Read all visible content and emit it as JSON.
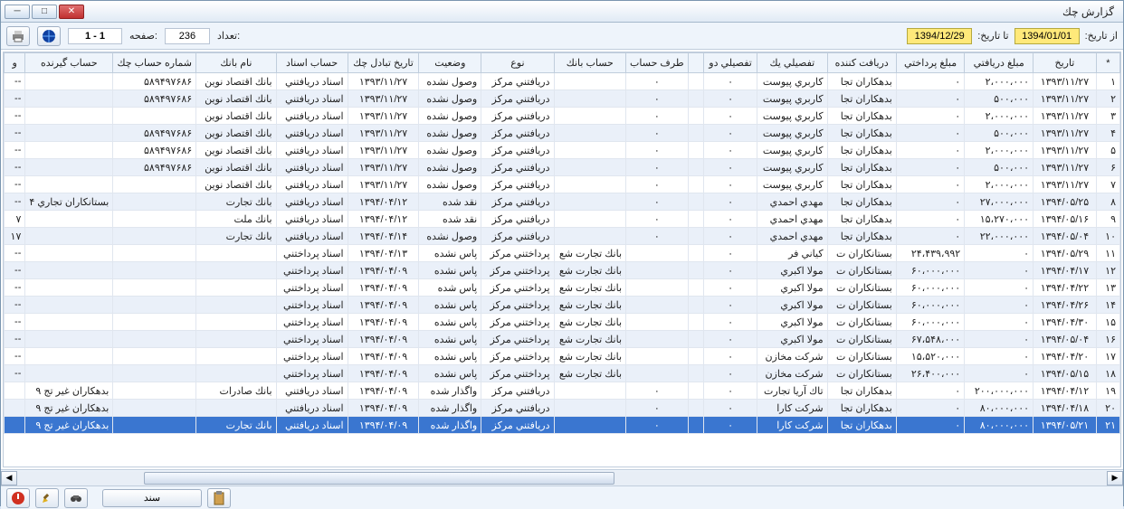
{
  "window": {
    "title": "گزارش چك"
  },
  "toolbar": {
    "from_label": "از تاریخ:",
    "from_value": "1394/01/01",
    "to_label": "تا تاریخ:",
    "to_value": "1394/12/29",
    "count_label": "تعداد:",
    "count_value": "236",
    "page_label": "صفحه:",
    "page_value": "1 - 1"
  },
  "columns": [
    "*",
    "تاريخ",
    "مبلغ دريافتي",
    "مبلغ پرداختي",
    "دريافت كننده",
    "تفصيلي يك",
    "تفصيلي دو",
    "",
    "طرف حساب",
    "حساب بانك",
    "نوع",
    "وضعيت",
    "تاريخ تبادل چك",
    "حساب اسناد",
    "نام بانك",
    "شماره حساب چك",
    "حساب گيرنده",
    "و"
  ],
  "rows": [
    {
      "n": "۱",
      "date": "۱۳۹۳/۱۱/۲۷",
      "recv": "۲،۰۰۰،۰۰۰",
      "pay": "۰",
      "receiver": "بدهکاران تجا",
      "t1": "کاربري پيوست",
      "t2": "۰",
      "t3": "",
      "side": "۰",
      "bank": "",
      "type": "دريافتني مرکز",
      "status": "وصول نشده",
      "exdate": "۱۳۹۳/۱۱/۲۷",
      "acct": "اسناد دريافتني",
      "bankn": "بانك اقتصاد نوين",
      "chkno": "۵۸۹۴۹۷۶۸۶",
      "dest": "",
      "x": "--"
    },
    {
      "n": "۲",
      "date": "۱۳۹۳/۱۱/۲۷",
      "recv": "۵۰۰،۰۰۰",
      "pay": "۰",
      "receiver": "بدهکاران تجا",
      "t1": "کاربري پيوست",
      "t2": "۰",
      "t3": "",
      "side": "۰",
      "bank": "",
      "type": "دريافتني مرکز",
      "status": "وصول نشده",
      "exdate": "۱۳۹۳/۱۱/۲۷",
      "acct": "اسناد دريافتني",
      "bankn": "بانك اقتصاد نوين",
      "chkno": "۵۸۹۴۹۷۶۸۶",
      "dest": "",
      "x": "--"
    },
    {
      "n": "۳",
      "date": "۱۳۹۳/۱۱/۲۷",
      "recv": "۲،۰۰۰،۰۰۰",
      "pay": "۰",
      "receiver": "بدهکاران تجا",
      "t1": "کاربري پيوست",
      "t2": "۰",
      "t3": "",
      "side": "۰",
      "bank": "",
      "type": "دريافتني مرکز",
      "status": "وصول نشده",
      "exdate": "۱۳۹۳/۱۱/۲۷",
      "acct": "اسناد دريافتني",
      "bankn": "بانك اقتصاد نوين",
      "chkno": "",
      "dest": "",
      "x": "--"
    },
    {
      "n": "۴",
      "date": "۱۳۹۳/۱۱/۲۷",
      "recv": "۵۰۰،۰۰۰",
      "pay": "۰",
      "receiver": "بدهکاران تجا",
      "t1": "کاربري پيوست",
      "t2": "۰",
      "t3": "",
      "side": "۰",
      "bank": "",
      "type": "دريافتني مرکز",
      "status": "وصول نشده",
      "exdate": "۱۳۹۳/۱۱/۲۷",
      "acct": "اسناد دريافتني",
      "bankn": "بانك اقتصاد نوين",
      "chkno": "۵۸۹۴۹۷۶۸۶",
      "dest": "",
      "x": "--"
    },
    {
      "n": "۵",
      "date": "۱۳۹۳/۱۱/۲۷",
      "recv": "۲،۰۰۰،۰۰۰",
      "pay": "۰",
      "receiver": "بدهکاران تجا",
      "t1": "کاربري پيوست",
      "t2": "۰",
      "t3": "",
      "side": "۰",
      "bank": "",
      "type": "دريافتني مرکز",
      "status": "وصول نشده",
      "exdate": "۱۳۹۳/۱۱/۲۷",
      "acct": "اسناد دريافتني",
      "bankn": "بانك اقتصاد نوين",
      "chkno": "۵۸۹۴۹۷۶۸۶",
      "dest": "",
      "x": "--"
    },
    {
      "n": "۶",
      "date": "۱۳۹۳/۱۱/۲۷",
      "recv": "۵۰۰،۰۰۰",
      "pay": "۰",
      "receiver": "بدهکاران تجا",
      "t1": "کاربري پيوست",
      "t2": "۰",
      "t3": "",
      "side": "۰",
      "bank": "",
      "type": "دريافتني مرکز",
      "status": "وصول نشده",
      "exdate": "۱۳۹۳/۱۱/۲۷",
      "acct": "اسناد دريافتني",
      "bankn": "بانك اقتصاد نوين",
      "chkno": "۵۸۹۴۹۷۶۸۶",
      "dest": "",
      "x": "--"
    },
    {
      "n": "۷",
      "date": "۱۳۹۳/۱۱/۲۷",
      "recv": "۲،۰۰۰،۰۰۰",
      "pay": "۰",
      "receiver": "بدهکاران تجا",
      "t1": "کاربري پيوست",
      "t2": "۰",
      "t3": "",
      "side": "۰",
      "bank": "",
      "type": "دريافتني مرکز",
      "status": "وصول نشده",
      "exdate": "۱۳۹۳/۱۱/۲۷",
      "acct": "اسناد دريافتني",
      "bankn": "بانك اقتصاد نوين",
      "chkno": "",
      "dest": "",
      "x": "--"
    },
    {
      "n": "۸",
      "date": "۱۳۹۴/۰۵/۲۵",
      "recv": "۲۷،۰۰۰،۰۰۰",
      "pay": "۰",
      "receiver": "بدهکاران تجا",
      "t1": "مهدي احمدي",
      "t2": "۰",
      "t3": "",
      "side": "۰",
      "bank": "",
      "type": "دريافتني مرکز",
      "status": "نقد شده",
      "exdate": "۱۳۹۴/۰۴/۱۲",
      "acct": "اسناد دريافتني",
      "bankn": "بانك تجارت",
      "chkno": "",
      "dest": "بستانكاران تجاري ۴",
      "x": "--"
    },
    {
      "n": "۹",
      "date": "۱۳۹۴/۰۵/۱۶",
      "recv": "۱۵،۲۷۰،۰۰۰",
      "pay": "۰",
      "receiver": "بدهکاران تجا",
      "t1": "مهدي احمدي",
      "t2": "۰",
      "t3": "",
      "side": "۰",
      "bank": "",
      "type": "دريافتني مرکز",
      "status": "نقد شده",
      "exdate": "۱۳۹۴/۰۴/۱۲",
      "acct": "اسناد دريافتني",
      "bankn": "بانك ملت",
      "chkno": "",
      "dest": "",
      "x": "۷"
    },
    {
      "n": "۱۰",
      "date": "۱۳۹۴/۰۵/۰۴",
      "recv": "۲۲،۰۰۰،۰۰۰",
      "pay": "۰",
      "receiver": "بدهکاران تجا",
      "t1": "مهدي احمدي",
      "t2": "۰",
      "t3": "",
      "side": "۰",
      "bank": "",
      "type": "دريافتني مرکز",
      "status": "وصول نشده",
      "exdate": "۱۳۹۴/۰۴/۱۴",
      "acct": "اسناد دريافتني",
      "bankn": "بانك تجارت",
      "chkno": "",
      "dest": "",
      "x": "۱۷"
    },
    {
      "n": "۱۱",
      "date": "۱۳۹۴/۰۵/۲۹",
      "recv": "۰",
      "pay": "۲۴،۴۳۹،۹۹۲",
      "receiver": "بستانكاران ت",
      "t1": "كياني فر",
      "t2": "۰",
      "t3": "",
      "side": "",
      "bank": "بانك تجارت شع",
      "type": "پرداختني مرکز",
      "status": "پاس نشده",
      "exdate": "۱۳۹۴/۰۴/۱۳",
      "acct": "اسناد پرداختني",
      "bankn": "",
      "chkno": "",
      "dest": "",
      "x": "--"
    },
    {
      "n": "۱۲",
      "date": "۱۳۹۴/۰۴/۱۷",
      "recv": "۰",
      "pay": "۶۰،۰۰۰،۰۰۰",
      "receiver": "بستانكاران ت",
      "t1": "مولا اكبري",
      "t2": "۰",
      "t3": "",
      "side": "",
      "bank": "بانك تجارت شع",
      "type": "پرداختني مرکز",
      "status": "پاس نشده",
      "exdate": "۱۳۹۴/۰۴/۰۹",
      "acct": "اسناد پرداختني",
      "bankn": "",
      "chkno": "",
      "dest": "",
      "x": "--"
    },
    {
      "n": "۱۳",
      "date": "۱۳۹۴/۰۴/۲۲",
      "recv": "۰",
      "pay": "۶۰،۰۰۰،۰۰۰",
      "receiver": "بستانكاران ت",
      "t1": "مولا اكبري",
      "t2": "۰",
      "t3": "",
      "side": "",
      "bank": "بانك تجارت شع",
      "type": "پرداختني مرکز",
      "status": "پاس شده",
      "exdate": "۱۳۹۴/۰۴/۰۹",
      "acct": "اسناد پرداختني",
      "bankn": "",
      "chkno": "",
      "dest": "",
      "x": "--"
    },
    {
      "n": "۱۴",
      "date": "۱۳۹۴/۰۴/۲۶",
      "recv": "۰",
      "pay": "۶۰،۰۰۰،۰۰۰",
      "receiver": "بستانكاران ت",
      "t1": "مولا اكبري",
      "t2": "۰",
      "t3": "",
      "side": "",
      "bank": "بانك تجارت شع",
      "type": "پرداختني مرکز",
      "status": "پاس نشده",
      "exdate": "۱۳۹۴/۰۴/۰۹",
      "acct": "اسناد پرداختني",
      "bankn": "",
      "chkno": "",
      "dest": "",
      "x": "--"
    },
    {
      "n": "۱۵",
      "date": "۱۳۹۴/۰۴/۳۰",
      "recv": "۰",
      "pay": "۶۰،۰۰۰،۰۰۰",
      "receiver": "بستانكاران ت",
      "t1": "مولا اكبري",
      "t2": "۰",
      "t3": "",
      "side": "",
      "bank": "بانك تجارت شع",
      "type": "پرداختني مرکز",
      "status": "پاس نشده",
      "exdate": "۱۳۹۴/۰۴/۰۹",
      "acct": "اسناد پرداختني",
      "bankn": "",
      "chkno": "",
      "dest": "",
      "x": "--"
    },
    {
      "n": "۱۶",
      "date": "۱۳۹۴/۰۵/۰۴",
      "recv": "۰",
      "pay": "۶۷،۵۴۸،۰۰۰",
      "receiver": "بستانكاران ت",
      "t1": "مولا اكبري",
      "t2": "۰",
      "t3": "",
      "side": "",
      "bank": "بانك تجارت شع",
      "type": "پرداختني مرکز",
      "status": "پاس نشده",
      "exdate": "۱۳۹۴/۰۴/۰۹",
      "acct": "اسناد پرداختني",
      "bankn": "",
      "chkno": "",
      "dest": "",
      "x": "--"
    },
    {
      "n": "۱۷",
      "date": "۱۳۹۴/۰۴/۲۰",
      "recv": "۰",
      "pay": "۱۵،۵۲۰،۰۰۰",
      "receiver": "بستانكاران ت",
      "t1": "شرکت مخازن",
      "t2": "۰",
      "t3": "",
      "side": "",
      "bank": "بانك تجارت شع",
      "type": "پرداختني مرکز",
      "status": "پاس نشده",
      "exdate": "۱۳۹۴/۰۴/۰۹",
      "acct": "اسناد پرداختني",
      "bankn": "",
      "chkno": "",
      "dest": "",
      "x": "--"
    },
    {
      "n": "۱۸",
      "date": "۱۳۹۴/۰۵/۱۵",
      "recv": "۰",
      "pay": "۲۶،۴۰۰،۰۰۰",
      "receiver": "بستانكاران ت",
      "t1": "شرکت مخازن",
      "t2": "۰",
      "t3": "",
      "side": "",
      "bank": "بانك تجارت شع",
      "type": "پرداختني مرکز",
      "status": "پاس نشده",
      "exdate": "۱۳۹۴/۰۴/۰۹",
      "acct": "اسناد پرداختني",
      "bankn": "",
      "chkno": "",
      "dest": "",
      "x": "--"
    },
    {
      "n": "۱۹",
      "date": "۱۳۹۴/۰۴/۱۲",
      "recv": "۲۰۰،۰۰۰،۰۰۰",
      "pay": "۰",
      "receiver": "بدهکاران تجا",
      "t1": "تاك آريا تجارت",
      "t2": "۰",
      "t3": "",
      "side": "۰",
      "bank": "",
      "type": "دريافتني مرکز",
      "status": "واگذار شده",
      "exdate": "۱۳۹۴/۰۴/۰۹",
      "acct": "اسناد دريافتني",
      "bankn": "بانك صادرات",
      "chkno": "",
      "dest": "بدهکاران غير تج ۹",
      "x": ""
    },
    {
      "n": "۲۰",
      "date": "۱۳۹۴/۰۴/۱۸",
      "recv": "۸۰،۰۰۰،۰۰۰",
      "pay": "۰",
      "receiver": "بدهکاران تجا",
      "t1": "شرکت کارا",
      "t2": "۰",
      "t3": "",
      "side": "۰",
      "bank": "",
      "type": "دريافتني مرکز",
      "status": "واگذار شده",
      "exdate": "۱۳۹۴/۰۴/۰۹",
      "acct": "اسناد دريافتني",
      "bankn": "",
      "chkno": "",
      "dest": "بدهکاران غير تج ۹",
      "x": ""
    },
    {
      "n": "۲۱",
      "date": "۱۳۹۴/۰۵/۲۱",
      "recv": "۸۰،۰۰۰،۰۰۰",
      "pay": "۰",
      "receiver": "بدهکاران تجا",
      "t1": "شرکت کارا",
      "t2": "۰",
      "t3": "",
      "side": "۰",
      "bank": "",
      "type": "دريافتني مرکز",
      "status": "واگذار شده",
      "exdate": "۱۳۹۴/۰۴/۰۹",
      "acct": "اسناد دريافتني",
      "bankn": "بانك تجارت",
      "chkno": "",
      "dest": "بدهکاران غير تج ۹",
      "x": "",
      "selected": true
    }
  ],
  "footer": {
    "sand_label": "سند"
  }
}
